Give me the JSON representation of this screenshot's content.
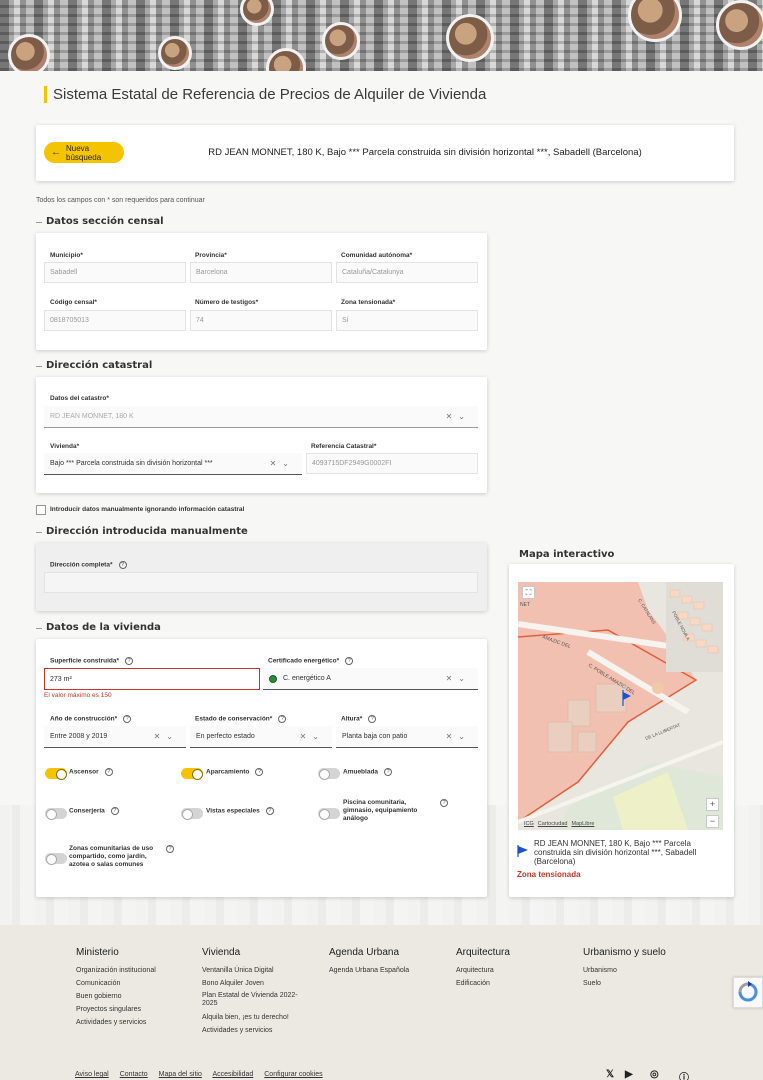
{
  "header": {
    "title": "Sistema Estatal de Referencia de Precios de Alquiler de Vivienda"
  },
  "search": {
    "new_search_label": "Nueva búsqueda",
    "address": "RD JEAN MONNET, 180 K, Bajo *** Parcela construida sin división horizontal ***, Sabadell (Barcelona)"
  },
  "required_note": "Todos los campos con * son requeridos para continuar",
  "census": {
    "title": "Datos sección censal",
    "municipio_label": "Municipio*",
    "municipio_value": "Sabadell",
    "provincia_label": "Provincia*",
    "provincia_value": "Barcelona",
    "comunidad_label": "Comunidad autónoma*",
    "comunidad_value": "Cataluña/Catalunya",
    "codigo_label": "Código censal*",
    "codigo_value": "0818705013",
    "testigos_label": "Número de testigos*",
    "testigos_value": "74",
    "zona_label": "Zona tensionada*",
    "zona_value": "Sí"
  },
  "catastral": {
    "title": "Dirección catastral",
    "datos_label": "Datos del catastro*",
    "datos_value": "RD JEAN MONNET, 180 K",
    "vivienda_label": "Vivienda*",
    "vivienda_value": "Bajo *** Parcela construida sin división horizontal ***",
    "referencia_label": "Referencia Catastral*",
    "referencia_value": "4093715DF2949G0002FI"
  },
  "manual": {
    "checkbox_label": "Introducir datos manualmente ignorando información catastral",
    "title": "Dirección introducida manualmente",
    "direccion_label": "Dirección completa*",
    "direccion_value": ""
  },
  "housing": {
    "title": "Datos de la vivienda",
    "superficie_label": "Superficie construida*",
    "superficie_value": "273  m²",
    "superficie_error": "El valor máximo es 150",
    "certificado_label": "Certificado energético*",
    "certificado_value": "C. energético A",
    "anio_label": "Año de construcción*",
    "anio_value": "Entre 2008 y 2019",
    "estado_label": "Estado de conservación*",
    "estado_value": "En perfecto estado",
    "altura_label": "Altura*",
    "altura_value": "Planta baja con patio",
    "toggles": {
      "ascensor": {
        "label": "Ascensor",
        "on": true
      },
      "aparcamiento": {
        "label": "Aparcamiento",
        "on": true
      },
      "amueblada": {
        "label": "Amueblada",
        "on": false
      },
      "conserjeria": {
        "label": "Conserjería",
        "on": false
      },
      "vistas": {
        "label": "Vistas especiales",
        "on": false
      },
      "piscina": {
        "label": "Piscina comunitaria, gimnasio, equipamiento análogo",
        "on": false
      },
      "zonas": {
        "label": "Zonas comunitarias de uso compartido, como jardín, azotea o salas comunes",
        "on": false
      }
    }
  },
  "map": {
    "title": "Mapa interactivo",
    "street_labels": [
      "NET",
      "C. CATALANS",
      "POBLE NOVA A",
      "AMAZIC DEL",
      "C. POBLE AMAZIC DEL",
      "DE LA LLIBERTAT"
    ],
    "zoom_in": "+",
    "zoom_out": "−",
    "attribution": [
      "ICG",
      "Cartociudad",
      "MapLibre"
    ],
    "address": "RD JEAN MONNET, 180 K, Bajo *** Parcela construida sin división horizontal ***, Sabadell (Barcelona)",
    "zona_label": "Zona tensionada"
  },
  "footer": {
    "columns": [
      {
        "title": "Ministerio",
        "links": [
          "Organización institucional",
          "Comunicación",
          "Buen gobierno",
          "Proyectos singulares",
          "Actividades y servicios"
        ]
      },
      {
        "title": "Vivienda",
        "links": [
          "Ventanilla Única Digital",
          "Bono Alquiler Joven",
          "Plan Estatal de Vivienda 2022-\n2025",
          "Alquila bien, ¡es tu derecho!",
          "Actividades y servicios"
        ]
      },
      {
        "title": "Agenda Urbana",
        "links": [
          "Agenda Urbana Española"
        ]
      },
      {
        "title": "Arquitectura",
        "links": [
          "Arquitectura",
          "Edificación"
        ]
      },
      {
        "title": "Urbanismo y suelo",
        "links": [
          "Urbanismo",
          "Suelo"
        ]
      }
    ],
    "bottom_links": [
      "Aviso legal",
      "Contacto",
      "Mapa del sitio",
      "Accesibilidad",
      "Configurar cookies"
    ],
    "social_icons": [
      "twitter-icon",
      "youtube-icon",
      "instagram-icon",
      "info-icon"
    ]
  },
  "colors": {
    "accent": "#f5c400",
    "error": "#c0392b",
    "energy_a": "#2e8b3e"
  }
}
